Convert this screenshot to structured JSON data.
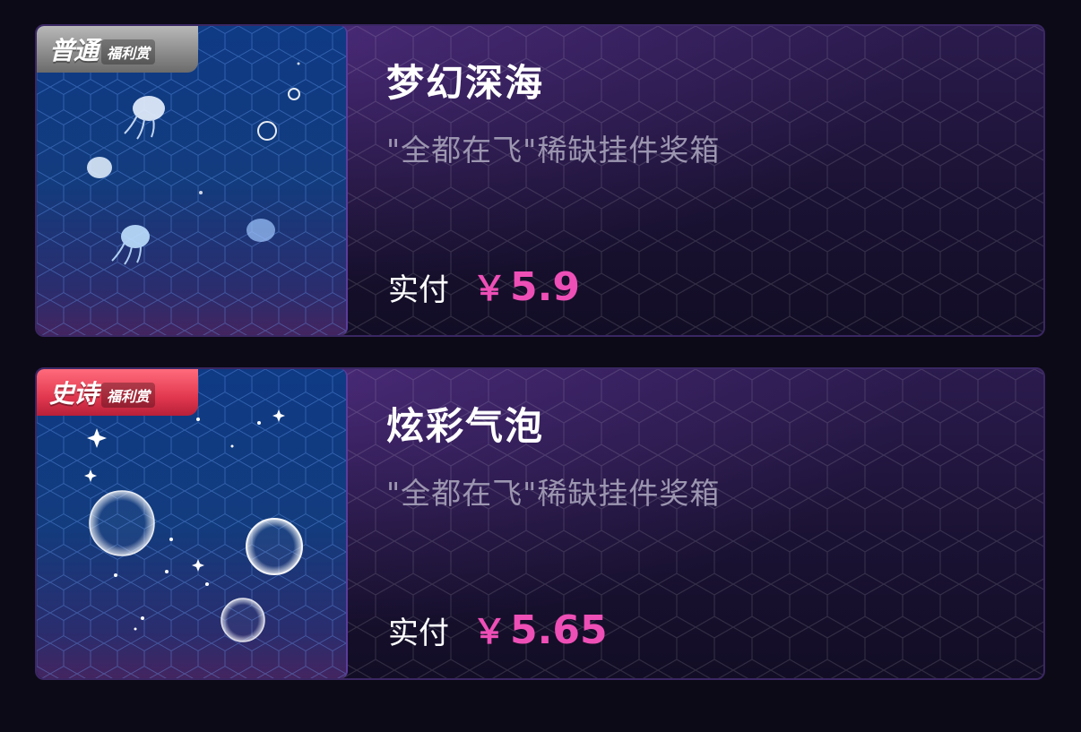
{
  "cards": [
    {
      "badge_tier": "普通",
      "badge_kind": "福利赏",
      "badge_style": "normal",
      "title": "梦幻深海",
      "subtitle": "\"全都在飞\"稀缺挂件奖箱",
      "price_label": "实付",
      "price_currency": "￥",
      "price_value": "5.9",
      "art_icon": "jellyfish-icon"
    },
    {
      "badge_tier": "史诗",
      "badge_kind": "福利赏",
      "badge_style": "epic",
      "title": "炫彩气泡",
      "subtitle": "\"全都在飞\"稀缺挂件奖箱",
      "price_label": "实付",
      "price_currency": "￥",
      "price_value": "5.65",
      "art_icon": "bubbles-icon"
    }
  ],
  "colors": {
    "price": "#ee4fb6",
    "card_border": "#3a2763",
    "thumb_bg": "#123c7e"
  }
}
